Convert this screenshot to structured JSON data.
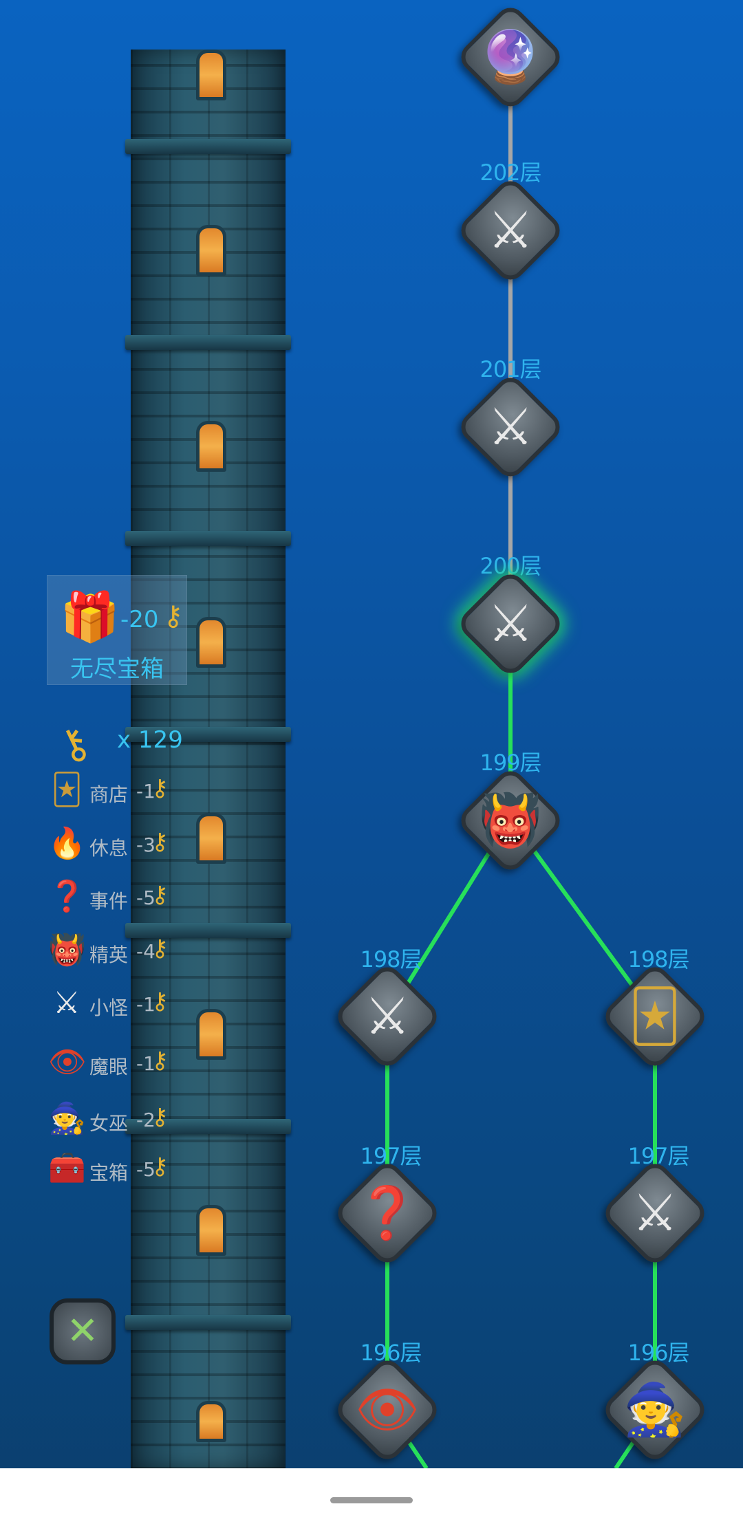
{
  "tower_map": {
    "nodes": [
      {
        "id": "top",
        "label": "",
        "type": "witch"
      },
      {
        "id": "n202",
        "label": "202层",
        "type": "monster"
      },
      {
        "id": "n201",
        "label": "201层",
        "type": "monster"
      },
      {
        "id": "n200",
        "label": "200层",
        "type": "monster",
        "active": true
      },
      {
        "id": "n199",
        "label": "199层",
        "type": "elite"
      },
      {
        "id": "n198a",
        "label": "198层",
        "type": "monster"
      },
      {
        "id": "n198b",
        "label": "198层",
        "type": "shop"
      },
      {
        "id": "n197a",
        "label": "197层",
        "type": "event"
      },
      {
        "id": "n197b",
        "label": "197层",
        "type": "monster"
      },
      {
        "id": "n196a",
        "label": "196层",
        "type": "magic-eye"
      },
      {
        "id": "n196b",
        "label": "196层",
        "type": "witch"
      }
    ]
  },
  "chest": {
    "cost": "-20",
    "label": "无尽宝箱"
  },
  "keys": {
    "count": "x 129"
  },
  "legend": [
    {
      "icon": "shop-icon",
      "label": "商店",
      "cost": "-1"
    },
    {
      "icon": "rest-icon",
      "label": "休息",
      "cost": "-3"
    },
    {
      "icon": "event-icon",
      "label": "事件",
      "cost": "-5"
    },
    {
      "icon": "elite-icon",
      "label": "精英",
      "cost": "-4"
    },
    {
      "icon": "monster-icon",
      "label": "小怪",
      "cost": "-1"
    },
    {
      "icon": "magic-eye-icon",
      "label": "魔眼",
      "cost": "-1"
    },
    {
      "icon": "witch-icon",
      "label": "女巫",
      "cost": "-2"
    },
    {
      "icon": "chest-icon",
      "label": "宝箱",
      "cost": "-5"
    }
  ],
  "colors": {
    "label": "#2fb4ee",
    "path_active": "#27e05a",
    "path_inactive": "#a7a7a7",
    "key": "#e4b232"
  }
}
